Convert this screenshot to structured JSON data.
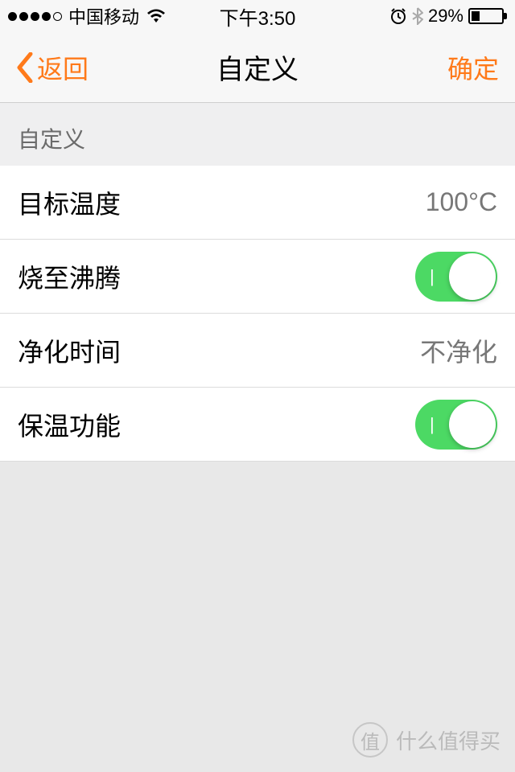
{
  "status_bar": {
    "carrier": "中国移动",
    "time": "下午3:50",
    "battery_percent": "29%"
  },
  "nav": {
    "back_label": "返回",
    "title": "自定义",
    "confirm_label": "确定"
  },
  "section": {
    "header": "自定义"
  },
  "rows": {
    "target_temp": {
      "label": "目标温度",
      "value": "100°C"
    },
    "boil": {
      "label": "烧至沸腾",
      "on": true
    },
    "purify_time": {
      "label": "净化时间",
      "value": "不净化"
    },
    "keep_warm": {
      "label": "保温功能",
      "on": true
    }
  },
  "watermark": {
    "text": "什么值得买",
    "badge": "值"
  }
}
